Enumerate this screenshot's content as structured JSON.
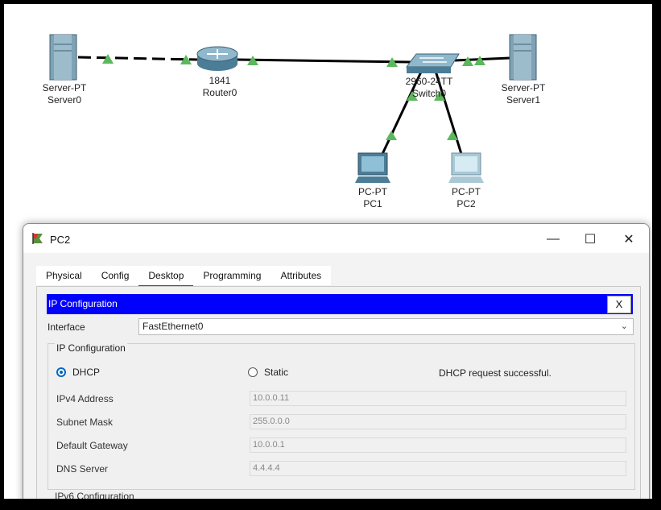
{
  "topology": {
    "devices": [
      {
        "model": "Server-PT",
        "name": "Server0"
      },
      {
        "model": "1841",
        "name": "Router0"
      },
      {
        "model": "2960-24TT",
        "name": "Switch0"
      },
      {
        "model": "Server-PT",
        "name": "Server1"
      },
      {
        "model": "PC-PT",
        "name": "PC1"
      },
      {
        "model": "PC-PT",
        "name": "PC2"
      }
    ]
  },
  "window": {
    "title": "PC2",
    "controls": {
      "minimize": "—",
      "maximize": "☐",
      "close": "✕"
    },
    "tabs": [
      "Physical",
      "Config",
      "Desktop",
      "Programming",
      "Attributes"
    ],
    "active_tab": "Desktop"
  },
  "ip_config": {
    "header": "IP Configuration",
    "close_label": "X",
    "interface_label": "Interface",
    "interface_value": "FastEthernet0",
    "group_title": "IP Configuration",
    "dhcp_label": "DHCP",
    "static_label": "Static",
    "selected_mode": "DHCP",
    "status": "DHCP request successful.",
    "fields": [
      {
        "label": "IPv4 Address",
        "value": "10.0.0.11"
      },
      {
        "label": "Subnet Mask",
        "value": "255.0.0.0"
      },
      {
        "label": "Default Gateway",
        "value": "10.0.0.1"
      },
      {
        "label": "DNS Server",
        "value": "4.4.4.4"
      }
    ],
    "ipv6_title": "IPv6 Configuration"
  },
  "colors": {
    "link_up": "#5cb85c",
    "ip_bar": "#0000ff",
    "tab_accent": "#2b5797"
  }
}
